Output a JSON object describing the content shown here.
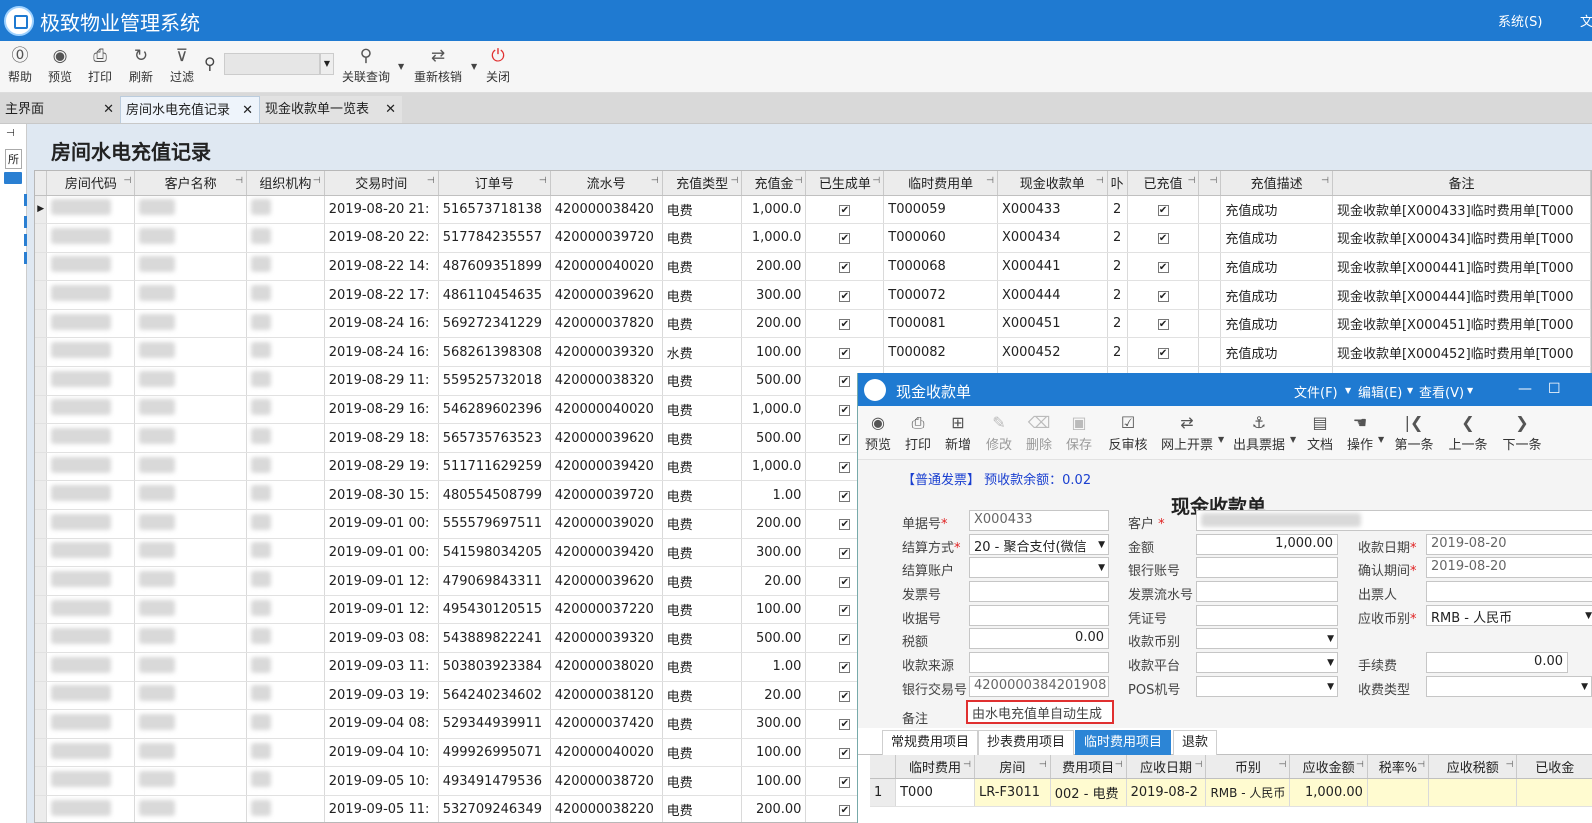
{
  "app": {
    "title": "极致物业管理系统",
    "menu_system": "系统(S)",
    "menu_more": "文"
  },
  "toolbar": {
    "help": "帮助",
    "preview": "预览",
    "print": "打印",
    "refresh": "刷新",
    "filter": "过滤",
    "search_value": "",
    "related_query": "关联查询",
    "reconcile": "重新核销",
    "close": "关闭"
  },
  "tabs": [
    {
      "label": "主界面"
    },
    {
      "label": "房间水电充值记录"
    },
    {
      "label": "现金收款单一览表"
    }
  ],
  "left_strip": {
    "pin": "ꟷ",
    "label": "所"
  },
  "page_title": "房间水电充值记录",
  "grid": {
    "columns": [
      "房间代码",
      "客户名称",
      "组织机构",
      "交易时间",
      "订单号",
      "流水号",
      "充值类型",
      "充值金",
      "已生成单",
      "临时费用单",
      "现金收款单",
      "卟",
      "已充值",
      "",
      "充值描述",
      "备注"
    ],
    "rows": [
      {
        "time": "2019-08-20 21:",
        "order": "516573718138",
        "serial": "420000038420",
        "type": "电费",
        "amount": "1,000.0",
        "gen": "✔",
        "temp": "T000059",
        "cash": "X000433",
        "n": "2",
        "paid": "✔",
        "desc": "充值成功",
        "remark": "现金收款单[X000433]临时费用单[T000"
      },
      {
        "time": "2019-08-20 22:",
        "order": "517784235557",
        "serial": "420000039720",
        "type": "电费",
        "amount": "1,000.0",
        "gen": "✔",
        "temp": "T000060",
        "cash": "X000434",
        "n": "2",
        "paid": "✔",
        "desc": "充值成功",
        "remark": "现金收款单[X000434]临时费用单[T000"
      },
      {
        "time": "2019-08-22 14:",
        "order": "487609351899",
        "serial": "420000040020",
        "type": "电费",
        "amount": "200.00",
        "gen": "✔",
        "temp": "T000068",
        "cash": "X000441",
        "n": "2",
        "paid": "✔",
        "desc": "充值成功",
        "remark": "现金收款单[X000441]临时费用单[T000"
      },
      {
        "time": "2019-08-22 17:",
        "order": "486110454635",
        "serial": "420000039620",
        "type": "电费",
        "amount": "300.00",
        "gen": "✔",
        "temp": "T000072",
        "cash": "X000444",
        "n": "2",
        "paid": "✔",
        "desc": "充值成功",
        "remark": "现金收款单[X000444]临时费用单[T000"
      },
      {
        "time": "2019-08-24 16:",
        "order": "569272341229",
        "serial": "420000037820",
        "type": "电费",
        "amount": "200.00",
        "gen": "✔",
        "temp": "T000081",
        "cash": "X000451",
        "n": "2",
        "paid": "✔",
        "desc": "充值成功",
        "remark": "现金收款单[X000451]临时费用单[T000"
      },
      {
        "time": "2019-08-24 16:",
        "order": "568261398308",
        "serial": "420000039320",
        "type": "水费",
        "amount": "100.00",
        "gen": "✔",
        "temp": "T000082",
        "cash": "X000452",
        "n": "2",
        "paid": "✔",
        "desc": "充值成功",
        "remark": "现金收款单[X000452]临时费用单[T000"
      },
      {
        "time": "2019-08-29 11:",
        "order": "559525732018",
        "serial": "420000038320",
        "type": "电费",
        "amount": "500.00",
        "gen": "✔",
        "temp": "",
        "cash": "",
        "n": "",
        "paid": "",
        "desc": "",
        "remark": ""
      },
      {
        "time": "2019-08-29 16:",
        "order": "546289602396",
        "serial": "420000040020",
        "type": "电费",
        "amount": "1,000.0",
        "gen": "✔",
        "temp": "",
        "cash": "",
        "n": "",
        "paid": "",
        "desc": "",
        "remark": ""
      },
      {
        "time": "2019-08-29 18:",
        "order": "565735763523",
        "serial": "420000039620",
        "type": "电费",
        "amount": "500.00",
        "gen": "✔",
        "temp": "",
        "cash": "",
        "n": "",
        "paid": "",
        "desc": "",
        "remark": ""
      },
      {
        "time": "2019-08-29 19:",
        "order": "511711629259",
        "serial": "420000039420",
        "type": "电费",
        "amount": "1,000.0",
        "gen": "✔",
        "temp": "",
        "cash": "",
        "n": "",
        "paid": "",
        "desc": "",
        "remark": ""
      },
      {
        "time": "2019-08-30 15:",
        "order": "480554508799",
        "serial": "420000039720",
        "type": "电费",
        "amount": "1.00",
        "gen": "✔",
        "temp": "",
        "cash": "",
        "n": "",
        "paid": "",
        "desc": "",
        "remark": ""
      },
      {
        "time": "2019-09-01 00:",
        "order": "555579697511",
        "serial": "420000039020",
        "type": "电费",
        "amount": "200.00",
        "gen": "✔",
        "temp": "",
        "cash": "",
        "n": "",
        "paid": "",
        "desc": "",
        "remark": ""
      },
      {
        "time": "2019-09-01 00:",
        "order": "541598034205",
        "serial": "420000039420",
        "type": "电费",
        "amount": "300.00",
        "gen": "✔",
        "temp": "",
        "cash": "",
        "n": "",
        "paid": "",
        "desc": "",
        "remark": ""
      },
      {
        "time": "2019-09-01 12:",
        "order": "479069843311",
        "serial": "420000039620",
        "type": "电费",
        "amount": "20.00",
        "gen": "✔",
        "temp": "",
        "cash": "",
        "n": "",
        "paid": "",
        "desc": "",
        "remark": ""
      },
      {
        "time": "2019-09-01 12:",
        "order": "495430120515",
        "serial": "420000037220",
        "type": "电费",
        "amount": "100.00",
        "gen": "✔",
        "temp": "",
        "cash": "",
        "n": "",
        "paid": "",
        "desc": "",
        "remark": ""
      },
      {
        "time": "2019-09-03 08:",
        "order": "543889822241",
        "serial": "420000039320",
        "type": "电费",
        "amount": "500.00",
        "gen": "✔",
        "temp": "",
        "cash": "",
        "n": "",
        "paid": "",
        "desc": "",
        "remark": ""
      },
      {
        "time": "2019-09-03 11:",
        "order": "503803923384",
        "serial": "420000038020",
        "type": "电费",
        "amount": "1.00",
        "gen": "✔",
        "temp": "",
        "cash": "",
        "n": "",
        "paid": "",
        "desc": "",
        "remark": ""
      },
      {
        "time": "2019-09-03 19:",
        "order": "564240234602",
        "serial": "420000038120",
        "type": "电费",
        "amount": "20.00",
        "gen": "✔",
        "temp": "",
        "cash": "",
        "n": "",
        "paid": "",
        "desc": "",
        "remark": ""
      },
      {
        "time": "2019-09-04 08:",
        "order": "529344939911",
        "serial": "420000037420",
        "type": "电费",
        "amount": "300.00",
        "gen": "✔",
        "temp": "",
        "cash": "",
        "n": "",
        "paid": "",
        "desc": "",
        "remark": ""
      },
      {
        "time": "2019-09-04 10:",
        "order": "499926995071",
        "serial": "420000040020",
        "type": "电费",
        "amount": "100.00",
        "gen": "✔",
        "temp": "",
        "cash": "",
        "n": "",
        "paid": "",
        "desc": "",
        "remark": ""
      },
      {
        "time": "2019-09-05 10:",
        "order": "493491479536",
        "serial": "420000038720",
        "type": "电费",
        "amount": "100.00",
        "gen": "✔",
        "temp": "",
        "cash": "",
        "n": "",
        "paid": "",
        "desc": "",
        "remark": ""
      },
      {
        "time": "2019-09-05 11:",
        "order": "532709246349",
        "serial": "420000038220",
        "type": "电费",
        "amount": "200.00",
        "gen": "✔",
        "temp": "",
        "cash": "",
        "n": "",
        "paid": "",
        "desc": "",
        "remark": ""
      }
    ]
  },
  "dialog": {
    "title": "现金收款单",
    "menu_file": "文件(F)",
    "menu_edit": "编辑(E)",
    "menu_view": "查看(V)",
    "min": "—",
    "max": "☐",
    "toolbar": {
      "preview": "预览",
      "print": "打印",
      "add": "新增",
      "edit": "修改",
      "delete": "删除",
      "save": "保存",
      "unverify": "反审核",
      "online_invoice": "网上开票",
      "issue_receipt": "出具票据",
      "docs": "文档",
      "operate": "操作",
      "first": "第一条",
      "prev": "上一条",
      "next": "下一条"
    },
    "invoice_type": "【普通发票】",
    "prepay_label": "预收款余额：0.02",
    "form_title": "现金收款单",
    "fields": {
      "doc_no_label": "单据号",
      "doc_no": "X000433",
      "customer_label": "客户",
      "settle_method_label": "结算方式",
      "settle_method": "20 - 聚合支付(微信",
      "amount_label": "金额",
      "amount": "1,000.00",
      "receipt_date_label": "收款日期",
      "receipt_date": "2019-08-20",
      "settle_account_label": "结算账户",
      "bank_account_label": "银行账号",
      "confirm_period_label": "确认期间",
      "confirm_period": "2019-08-20",
      "invoice_no_label": "发票号",
      "invoice_serial_label": "发票流水号",
      "drawer_label": "出票人",
      "receipt_no_label": "收据号",
      "voucher_label": "凭证号",
      "currency_label": "应收币别",
      "currency": "RMB - 人民币",
      "tax_label": "税额",
      "tax": "0.00",
      "recv_currency_label": "收款币别",
      "source_label": "收款来源",
      "platform_label": "收款平台",
      "fee_label": "手续费",
      "fee": "0.00",
      "bank_txn_label": "银行交易号",
      "bank_txn": "4200000384201908",
      "pos_label": "POS机号",
      "fee_type_label": "收费类型",
      "remark_label": "备注",
      "remark": "由水电充值单自动生成"
    },
    "tabs": [
      "常规费用项目",
      "抄表费用项目",
      "临时费用项目",
      "退款"
    ],
    "items": {
      "columns": [
        "临时费用",
        "房间",
        "费用项目",
        "应收日期",
        "币别",
        "应收金额",
        "税率%",
        "应收税额",
        "已收金"
      ],
      "rows": [
        {
          "idx": "1",
          "temp": "T000",
          "room": "LR-F3011",
          "item": "002 - 电费",
          "date": "2019-08-2",
          "currency": "RMB - 人民币",
          "amount": "1,000.00"
        }
      ]
    }
  },
  "colors": {
    "titlebar": "#1f7ad1",
    "active_tab": "#2c85d6",
    "required": "#e02020",
    "highlight_border": "#e03030"
  }
}
